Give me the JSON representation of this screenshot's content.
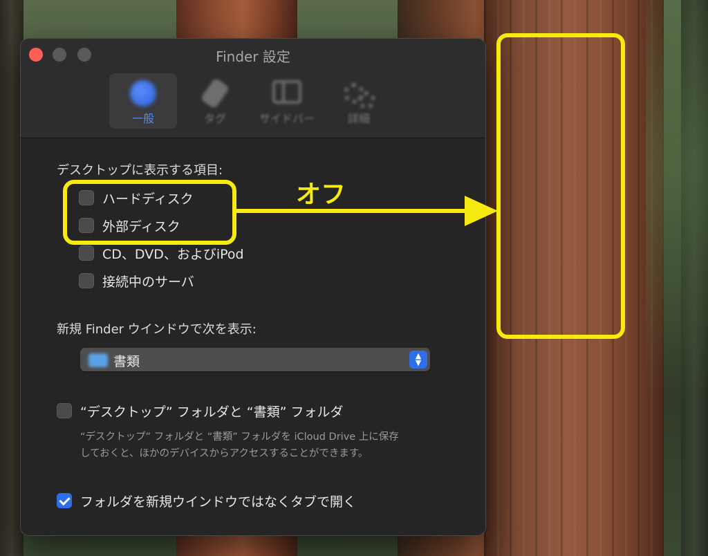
{
  "window": {
    "title": "Finder 設定"
  },
  "tabs": [
    {
      "label": "一般",
      "active": true
    },
    {
      "label": "タグ",
      "active": false
    },
    {
      "label": "サイドバー",
      "active": false
    },
    {
      "label": "詳細",
      "active": false
    }
  ],
  "desktop_section": {
    "heading": "デスクトップに表示する項目:",
    "items": [
      {
        "label": "ハードディスク",
        "checked": false
      },
      {
        "label": "外部ディスク",
        "checked": false
      },
      {
        "label": "CD、DVD、およびiPod",
        "checked": false
      },
      {
        "label": "接続中のサーバ",
        "checked": false
      }
    ]
  },
  "new_window_section": {
    "heading": "新規 Finder ウインドウで次を表示:",
    "selected": "書類"
  },
  "icloud": {
    "label": "“デスクトップ” フォルダと “書類” フォルダ",
    "checked": false,
    "description": "“デスクトップ” フォルダと “書類” フォルダを iCloud Drive 上に保存しておくと、ほかのデバイスからアクセスすることができます。"
  },
  "tabs_option": {
    "label": "フォルダを新規ウインドウではなくタブで開く",
    "checked": true
  },
  "annotation": {
    "text": "オフ",
    "color": "#f6ea10"
  },
  "colors": {
    "accent": "#2f6ee9",
    "close": "#ff5f57"
  }
}
